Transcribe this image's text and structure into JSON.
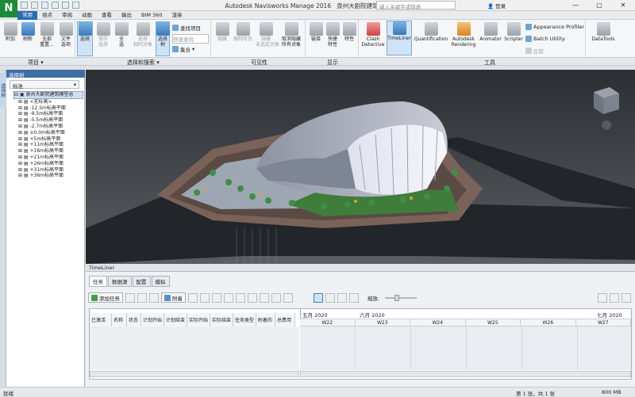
{
  "app": {
    "logo": "N",
    "title": "Autodesk Navisworks Manage 2016",
    "file": "泉州大剧院建筑模型总.nwc",
    "search_placeholder": "键入关键字或短语",
    "login_label": "登录",
    "window_buttons": [
      "—",
      "▢",
      "✕"
    ]
  },
  "tabs": [
    "常用",
    "视点",
    "审阅",
    "动画",
    "查看",
    "输出",
    "BIM 360",
    "渲染"
  ],
  "active_tab": 0,
  "ribbon": {
    "project": {
      "label": "项目 ▾",
      "buttons": [
        "附加",
        "刷新",
        "全部\n重置...",
        "文件\n选项"
      ]
    },
    "select": {
      "label": "选择和搜索 ▾",
      "buttons": [
        "选择",
        "保存\n选择",
        "全\n选",
        "选择\n相同对象",
        "选择\n树"
      ],
      "find_items": "查找项目",
      "quick_find": "快速查找",
      "sets": "集合"
    },
    "visibility": {
      "label": "可见性",
      "buttons": [
        "隐藏",
        "强制可见",
        "隐藏\n未选定对象",
        "取消隐藏\n所有对象"
      ]
    },
    "display": {
      "label": "显示",
      "buttons": [
        "链接",
        "快捷\n特性",
        "特性"
      ]
    },
    "tools": {
      "label": "工具",
      "buttons": [
        "Clash\nDetective",
        "TimeLiner",
        "Quantification",
        "Autodesk\nRendering",
        "Animator",
        "Scripter"
      ],
      "small": [
        "Appearance Profiler",
        "Batch Utility",
        "比较"
      ],
      "datatools": "DataTools"
    }
  },
  "selection_tree": {
    "side_tab": "选择树",
    "title": "选择树",
    "dropdown": "标准",
    "root": "泉州大剧院建筑模型总",
    "items": [
      "<无标高>",
      "-12.5m标高平面",
      "-9.5m标高平面",
      "-5.5m标高平面",
      "-2.7m标高平面",
      "±0.0m标高平面",
      "+5m标高平面",
      "+11m标高平面",
      "+16m标高平面",
      "+21m标高平面",
      "+26m标高平面",
      "+31m标高平面",
      "+36m标高平面"
    ]
  },
  "timeliner": {
    "title": "TimeLiner",
    "tabs": [
      "任务",
      "数据源",
      "配置",
      "模拟"
    ],
    "add_task": "添加任务",
    "attach": "附着",
    "zoom_label": "缩放:",
    "columns": [
      "已激活",
      "名称",
      "状态",
      "计划开始",
      "计划结束",
      "实际开始",
      "实际结束",
      "任务类型",
      "附着的",
      "总费用"
    ],
    "months": [
      "五月 2020",
      "六月 2020",
      "七月 2020"
    ],
    "weeks": [
      "W22",
      "W23",
      "W24",
      "W25",
      "W26",
      "W27"
    ]
  },
  "status": {
    "left": "就绪",
    "page": "第 1 张，共 1 张",
    "memory": "800 MB"
  }
}
